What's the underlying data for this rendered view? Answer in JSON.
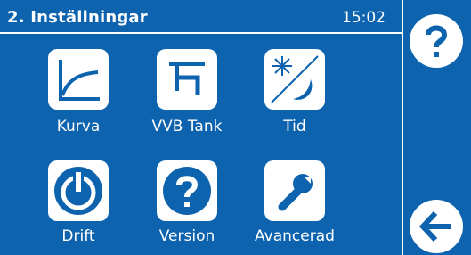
{
  "header": {
    "title": "2. Inställningar",
    "time": "15:02"
  },
  "menu": {
    "items": [
      {
        "label": "Kurva",
        "icon": "curve-icon"
      },
      {
        "label": "VVB Tank",
        "icon": "tap-icon"
      },
      {
        "label": "Tid",
        "icon": "day-night-icon"
      },
      {
        "label": "Drift",
        "icon": "power-icon"
      },
      {
        "label": "Version",
        "icon": "question-icon"
      },
      {
        "label": "Avancerad",
        "icon": "wrench-icon"
      }
    ]
  },
  "sidebar": {
    "help_icon": "question-icon",
    "back_icon": "back-arrow-icon"
  },
  "colors": {
    "background": "#0d63ae",
    "foreground": "#ffffff"
  }
}
